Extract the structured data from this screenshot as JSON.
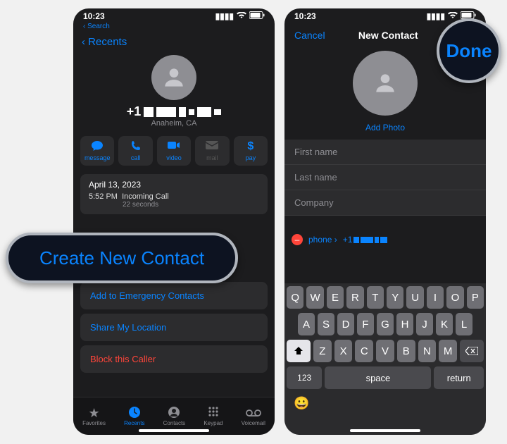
{
  "status_time": "10:23",
  "back_search": "Search",
  "left": {
    "back_label": "Recents",
    "phone_prefix": "+1",
    "location": "Anaheim, CA",
    "actions": [
      {
        "key": "message",
        "label": "message"
      },
      {
        "key": "call",
        "label": "call"
      },
      {
        "key": "video",
        "label": "video"
      },
      {
        "key": "mail",
        "label": "mail"
      },
      {
        "key": "pay",
        "label": "pay"
      }
    ],
    "call_log": {
      "date": "April 13, 2023",
      "time": "5:52 PM",
      "type": "Incoming Call",
      "duration": "22 seconds"
    },
    "emergency_label": "Add to Emergency Contacts",
    "share_label": "Share My Location",
    "block_label": "Block this Caller",
    "tabs": [
      {
        "key": "favorites",
        "label": "Favorites"
      },
      {
        "key": "recents",
        "label": "Recents"
      },
      {
        "key": "contacts",
        "label": "Contacts"
      },
      {
        "key": "keypad",
        "label": "Keypad"
      },
      {
        "key": "voicemail",
        "label": "Voicemail"
      }
    ]
  },
  "right": {
    "cancel_label": "Cancel",
    "title": "New Contact",
    "done_label": "Done",
    "add_photo": "Add Photo",
    "fields": {
      "first_name_ph": "First name",
      "last_name_ph": "Last name",
      "company_ph": "Company"
    },
    "phone_type": "phone",
    "phone_prefix": "+1",
    "keyboard": {
      "row1": [
        "Q",
        "W",
        "E",
        "R",
        "T",
        "Y",
        "U",
        "I",
        "O",
        "P"
      ],
      "row2": [
        "A",
        "S",
        "D",
        "F",
        "G",
        "H",
        "J",
        "K",
        "L"
      ],
      "row3": [
        "Z",
        "X",
        "C",
        "V",
        "B",
        "N",
        "M"
      ],
      "num_key": "123",
      "space_key": "space",
      "return_key": "return"
    }
  },
  "callouts": {
    "create": "Create New Contact",
    "done": "Done"
  }
}
